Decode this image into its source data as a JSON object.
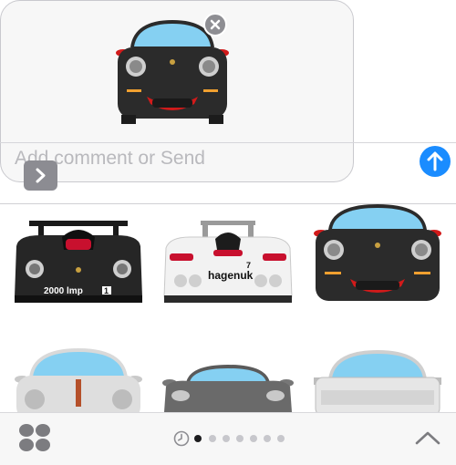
{
  "compose": {
    "placeholder": "Add comment or Send",
    "send_button": "send-arrow",
    "remove_button": "close-x"
  },
  "sticker_grid": {
    "rows": [
      [
        {
          "name": "black-le-mans-prototype",
          "label": "2000 lmp",
          "badge": "1"
        },
        {
          "name": "white-le-mans-racer",
          "label": "hagenuk",
          "number": "7"
        },
        {
          "name": "black-911-gt3-front"
        }
      ],
      [
        {
          "name": "silver-911-front"
        },
        {
          "name": "grey-918-front"
        },
        {
          "name": "white-928-front"
        }
      ]
    ]
  },
  "toolbar": {
    "apps_icon": "app-grid-icon",
    "recents_icon": "clock-icon",
    "page_count": 7,
    "active_page": 1,
    "collapse_icon": "chevron-up-icon"
  },
  "colors": {
    "send_blue": "#1a8cff",
    "windshield": "#85d0f2",
    "car_black": "#2b2b2b",
    "taillight_red": "#d11a1a"
  }
}
